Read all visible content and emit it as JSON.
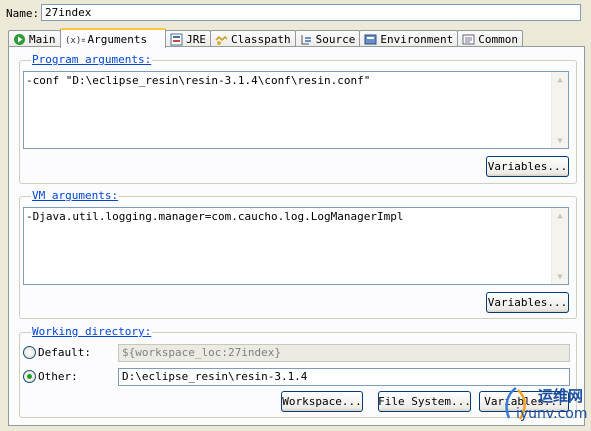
{
  "name": {
    "label": "Name:",
    "value": "27index"
  },
  "tabs": [
    {
      "label": "Main",
      "icon": "run-icon",
      "selected": false
    },
    {
      "label": "Arguments",
      "icon": "arguments-icon",
      "selected": true
    },
    {
      "label": "JRE",
      "icon": "jre-icon",
      "selected": false
    },
    {
      "label": "Classpath",
      "icon": "classpath-icon",
      "selected": false
    },
    {
      "label": "Source",
      "icon": "source-icon",
      "selected": false
    },
    {
      "label": "Environment",
      "icon": "environment-icon",
      "selected": false
    },
    {
      "label": "Common",
      "icon": "common-icon",
      "selected": false
    }
  ],
  "program_args": {
    "title": "Program arguments:",
    "value": "-conf \"D:\\eclipse_resin\\resin-3.1.4\\conf\\resin.conf\"",
    "variables_button": "Variables..."
  },
  "vm_args": {
    "title": "VM arguments:",
    "value": "-Djava.util.logging.manager=com.caucho.log.LogManagerImpl",
    "variables_button": "Variables..."
  },
  "working_dir": {
    "title": "Working directory:",
    "default_label": "Default:",
    "default_value": "${workspace_loc:27index}",
    "other_label": "Other:",
    "other_value": "D:\\eclipse_resin\\resin-3.1.4",
    "selected": "other",
    "workspace_button": "Workspace...",
    "filesystem_button": "File System...",
    "variables_button": "Variables..."
  },
  "watermark": {
    "text_cn": "运维网",
    "text_url": "iyunv.com"
  },
  "colors": {
    "group_title": "#0046d5",
    "tab_highlight": "#ffc83c",
    "radio_dot": "#21a121"
  }
}
